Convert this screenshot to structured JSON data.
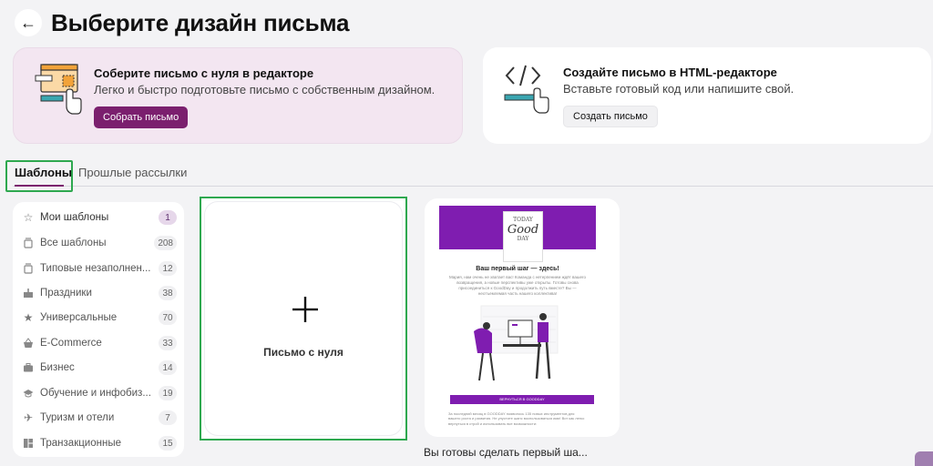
{
  "page": {
    "title": "Выберите дизайн письма",
    "back_icon": "arrow-left-icon"
  },
  "options": {
    "editor": {
      "title": "Соберите письмо с нуля в редакторе",
      "subtitle": "Легко и быстро подготовьте письмо с собственным дизайном.",
      "button": "Собрать письмо",
      "accent": "#7b1f6e",
      "background": "#f3e6f1"
    },
    "html": {
      "title": "Создайте письмо в HTML-редакторе",
      "subtitle": "Вставьте готовый код или напишите свой.",
      "button": "Создать письмо"
    }
  },
  "tabs": [
    {
      "label": "Шаблоны",
      "active": true
    },
    {
      "label": "Прошлые рассылки",
      "active": false
    }
  ],
  "sidebar": {
    "items": [
      {
        "label": "Мои шаблоны",
        "count": "1",
        "icon": "star-outline-icon"
      },
      {
        "label": "Все шаблоны",
        "count": "208",
        "icon": "template-stack-icon"
      },
      {
        "label": "Типовые незаполнен...",
        "count": "12",
        "icon": "template-stack-icon"
      },
      {
        "label": "Праздники",
        "count": "38",
        "icon": "cake-icon"
      },
      {
        "label": "Универсальные",
        "count": "70",
        "icon": "star-filled-icon"
      },
      {
        "label": "E-Commerce",
        "count": "33",
        "icon": "basket-icon"
      },
      {
        "label": "Бизнес",
        "count": "14",
        "icon": "briefcase-icon"
      },
      {
        "label": "Обучение и инфобиз...",
        "count": "19",
        "icon": "graduation-cap-icon"
      },
      {
        "label": "Туризм и отели",
        "count": "7",
        "icon": "airplane-icon"
      },
      {
        "label": "Транзакционные",
        "count": "15",
        "icon": "layout-icon"
      }
    ]
  },
  "blank_template": {
    "label": "Письмо с нуля",
    "icon": "plus-icon"
  },
  "templates": [
    {
      "name": "Вы готовы сделать первый ша...",
      "preview": {
        "logo_top": "TODAY",
        "logo_mid": "Good",
        "logo_bottom": "DAY",
        "heading": "Ваш первый шаг — здесь!",
        "body": "Мария, нам очень не хватает вас! Команда с нетерпением ждёт вашего возвращения, а новые перспективы уже открыты. Готовы снова присоединиться к GoodDay и продолжить путь вместе? Вы — неотъемлемая часть нашего коллектива!",
        "button": "ВЕРНУТЬСЯ В GOODDAY",
        "footer": "За последний месяц в GOODDAY появилось 135 новых инструментов для вашего роста и развития. Не упустите шанс воспользоваться ими! Вот как легко вернуться в строй и использовать все возможности:"
      }
    }
  ]
}
